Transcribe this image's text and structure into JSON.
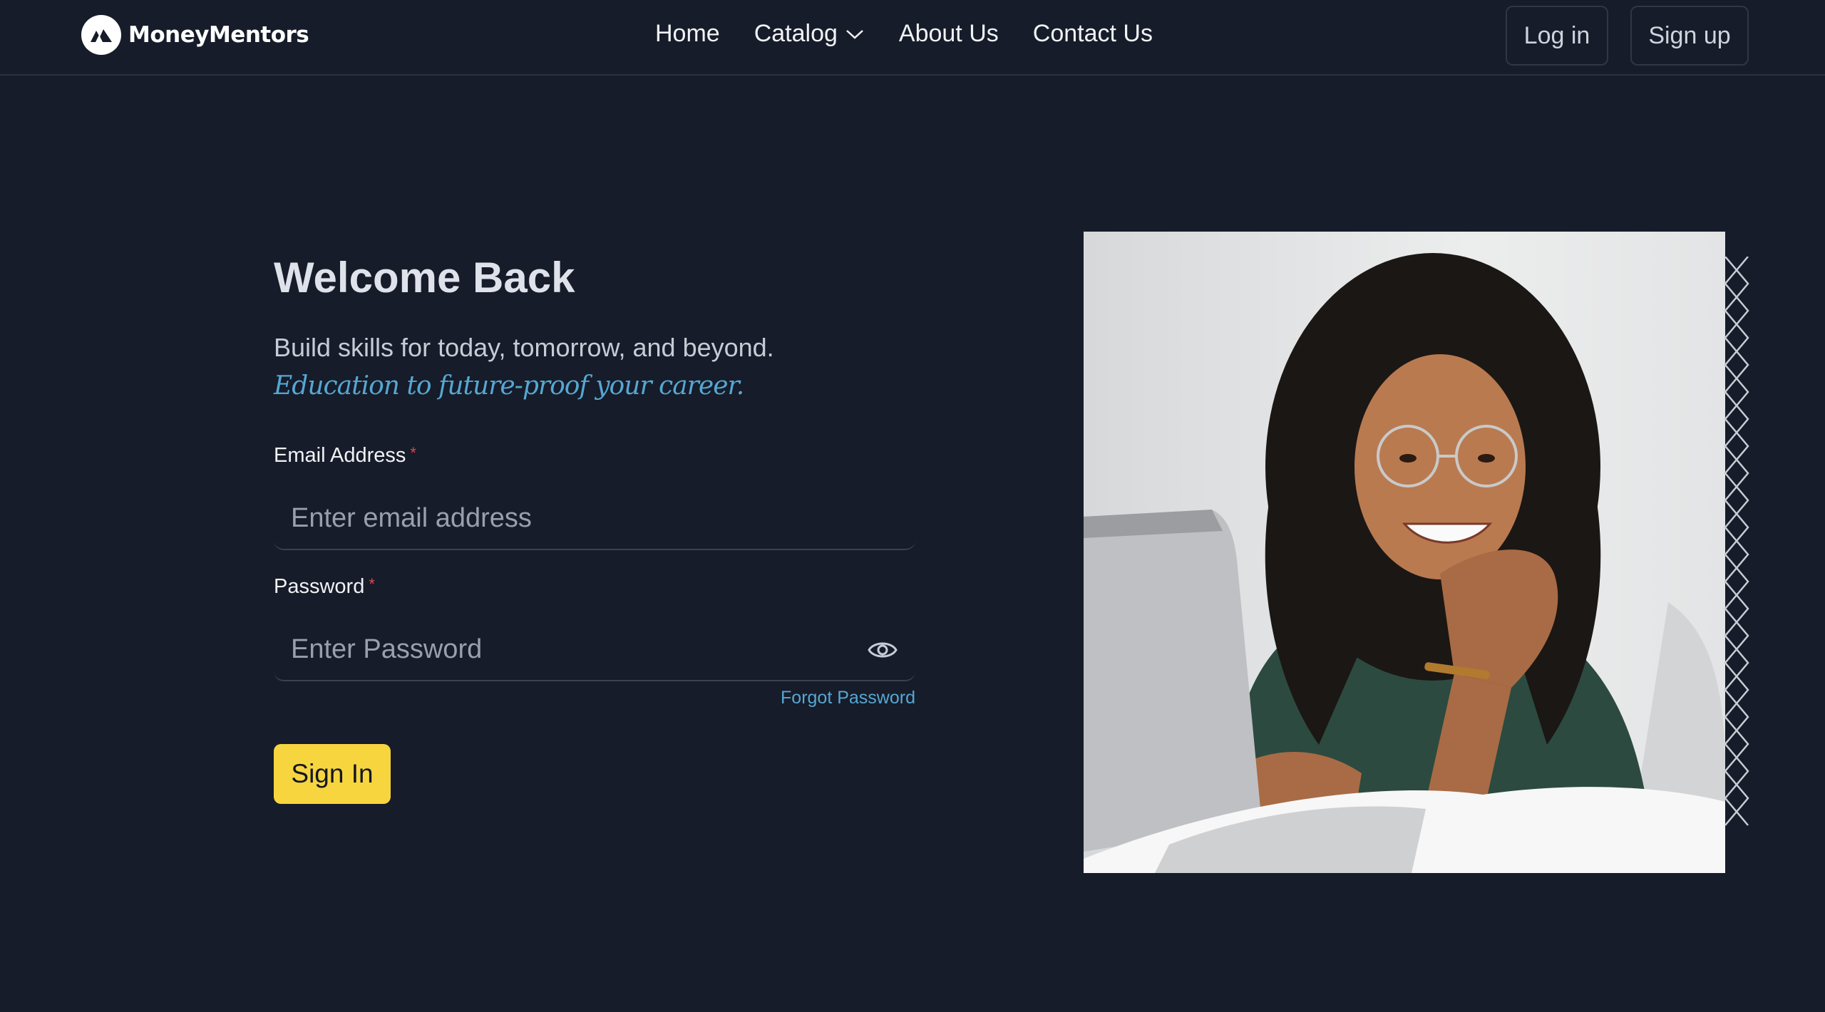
{
  "brand": {
    "name": "MoneyMentors",
    "logo_icon": "mountain-logo-icon"
  },
  "nav": {
    "links": [
      {
        "label": "Home"
      },
      {
        "label": "Catalog",
        "icon": "chevron-down-icon"
      },
      {
        "label": "About Us"
      },
      {
        "label": "Contact Us"
      }
    ],
    "login_label": "Log in",
    "signup_label": "Sign up"
  },
  "form": {
    "title": "Welcome Back",
    "subtitle": "Build skills for today, tomorrow, and beyond.",
    "tagline": "Education to future-proof your career.",
    "email_label": "Email Address",
    "email_placeholder": "Enter email address",
    "password_label": "Password",
    "password_placeholder": "Enter Password",
    "required_mark": "*",
    "forgot_label": "Forgot Password",
    "signin_label": "Sign In",
    "password_toggle_icon": "eye-icon"
  },
  "image": {
    "alt": "smiling woman with curly hair and glasses at a laptop"
  },
  "colors": {
    "background": "#161c29",
    "accent_yellow": "#f7d53e",
    "accent_blue": "#56a7d3",
    "required_red": "#e0474d"
  }
}
